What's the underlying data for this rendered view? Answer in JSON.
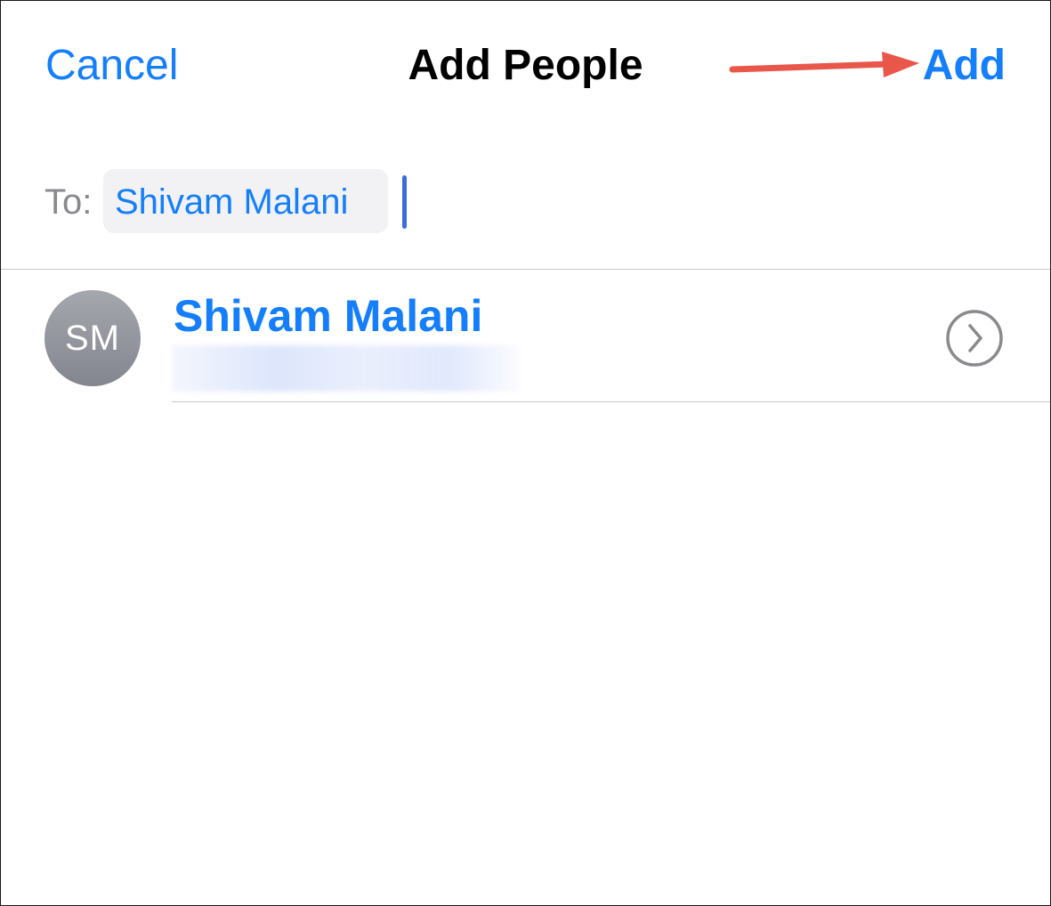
{
  "nav": {
    "cancel_label": "Cancel",
    "title": "Add People",
    "add_label": "Add"
  },
  "recipients": {
    "to_label": "To:",
    "tokens": [
      "Shivam Malani"
    ]
  },
  "suggestions": [
    {
      "initials": "SM",
      "name": "Shivam Malani",
      "detail_blurred": true
    }
  ],
  "icons": {
    "arrow": "arrow-right-annotation-icon",
    "info": "chevron-right-circle-icon"
  },
  "colors": {
    "accent": "#157efb",
    "annotation_arrow": "#e8574a",
    "secondary_text": "#8a8a8e",
    "separator": "#c7c7cc",
    "caret": "#3c6bdc"
  }
}
